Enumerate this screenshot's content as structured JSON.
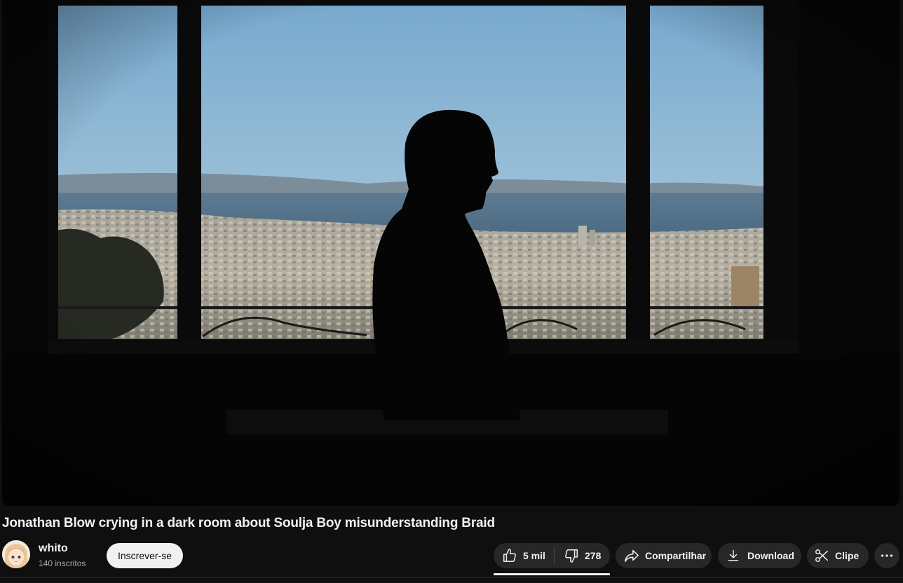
{
  "video": {
    "title": "Jonathan Blow crying in a dark room about Soulja Boy misunderstanding Braid",
    "thumbnail_icon": "video-frame-silhouette-window"
  },
  "channel": {
    "name": "whito",
    "subscribers": "140 inscritos",
    "avatar_icon": "anime-avatar-icon"
  },
  "actions": {
    "subscribe_label": "Inscrever-se",
    "like_count": "5 mil",
    "dislike_count": "278",
    "share_label": "Compartilhar",
    "download_label": "Download",
    "clip_label": "Clipe"
  },
  "colors": {
    "background": "#0f0f0f",
    "pill": "#272727",
    "subscribe_bg": "#f1f1f1",
    "text_primary": "#f1f1f1",
    "text_secondary": "#aaaaaa"
  }
}
